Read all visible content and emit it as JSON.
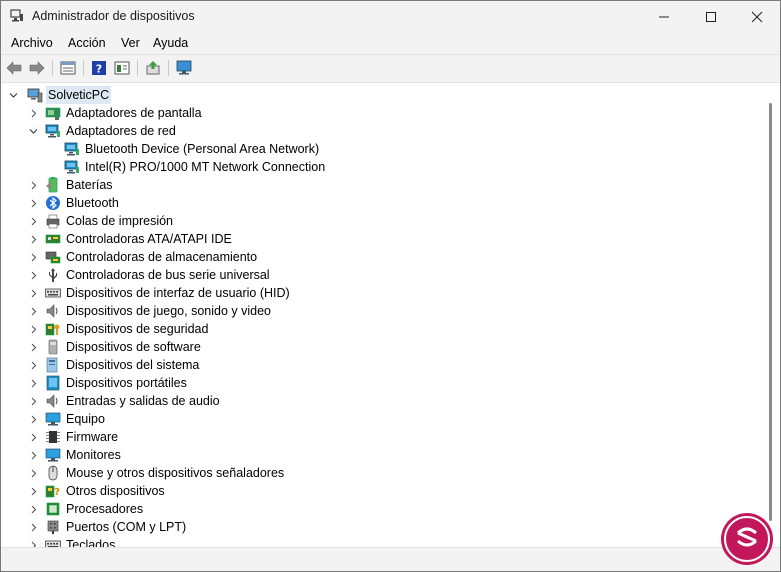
{
  "window": {
    "title": "Administrador de dispositivos"
  },
  "menu": [
    "Archivo",
    "Acción",
    "Ver",
    "Ayuda"
  ],
  "toolbar_icons": [
    "back-arrow-icon",
    "forward-arrow-icon",
    "properties-icon",
    "help-icon",
    "view-icon",
    "update-driver-icon",
    "monitor-scan-icon"
  ],
  "tree": {
    "root": "SolveticPC",
    "items": [
      {
        "label": "Adaptadores de pantalla",
        "icon": "display-adapter-icon",
        "expanded": false,
        "level": 1
      },
      {
        "label": "Adaptadores de red",
        "icon": "network-adapter-icon",
        "expanded": true,
        "level": 1
      },
      {
        "label": "Bluetooth Device (Personal Area Network)",
        "icon": "network-adapter-icon",
        "level": 2
      },
      {
        "label": "Intel(R) PRO/1000 MT Network Connection",
        "icon": "network-adapter-icon",
        "level": 2
      },
      {
        "label": "Baterías",
        "icon": "battery-icon",
        "expanded": false,
        "level": 1
      },
      {
        "label": "Bluetooth",
        "icon": "bluetooth-icon",
        "expanded": false,
        "level": 1
      },
      {
        "label": "Colas de impresión",
        "icon": "printer-icon",
        "expanded": false,
        "level": 1
      },
      {
        "label": "Controladoras ATA/ATAPI IDE",
        "icon": "ide-controller-icon",
        "expanded": false,
        "level": 1
      },
      {
        "label": "Controladoras de almacenamiento",
        "icon": "storage-controller-icon",
        "expanded": false,
        "level": 1
      },
      {
        "label": "Controladoras de bus serie universal",
        "icon": "usb-icon",
        "expanded": false,
        "level": 1
      },
      {
        "label": "Dispositivos de interfaz de usuario (HID)",
        "icon": "keyboard-hid-icon",
        "expanded": false,
        "level": 1
      },
      {
        "label": "Dispositivos de juego, sonido y video",
        "icon": "speaker-icon",
        "expanded": false,
        "level": 1
      },
      {
        "label": "Dispositivos de seguridad",
        "icon": "security-device-icon",
        "expanded": false,
        "level": 1
      },
      {
        "label": "Dispositivos de software",
        "icon": "software-device-icon",
        "expanded": false,
        "level": 1
      },
      {
        "label": "Dispositivos del sistema",
        "icon": "system-device-icon",
        "expanded": false,
        "level": 1
      },
      {
        "label": "Dispositivos portátiles",
        "icon": "portable-device-icon",
        "expanded": false,
        "level": 1
      },
      {
        "label": "Entradas y salidas de audio",
        "icon": "speaker-icon",
        "expanded": false,
        "level": 1
      },
      {
        "label": "Equipo",
        "icon": "computer-icon",
        "expanded": false,
        "level": 1
      },
      {
        "label": "Firmware",
        "icon": "firmware-icon",
        "expanded": false,
        "level": 1
      },
      {
        "label": "Monitores",
        "icon": "monitor-icon",
        "expanded": false,
        "level": 1
      },
      {
        "label": "Mouse y otros dispositivos señaladores",
        "icon": "mouse-icon",
        "expanded": false,
        "level": 1
      },
      {
        "label": "Otros dispositivos",
        "icon": "unknown-device-icon",
        "expanded": false,
        "level": 1
      },
      {
        "label": "Procesadores",
        "icon": "processor-icon",
        "expanded": false,
        "level": 1
      },
      {
        "label": "Puertos (COM y LPT)",
        "icon": "port-icon",
        "expanded": false,
        "level": 1
      },
      {
        "label": "Teclados",
        "icon": "keyboard-icon",
        "expanded": false,
        "level": 1
      }
    ]
  },
  "colors": {
    "accent": "#0078d4",
    "network": "#1e90c8",
    "watermark": "#c2185b"
  }
}
